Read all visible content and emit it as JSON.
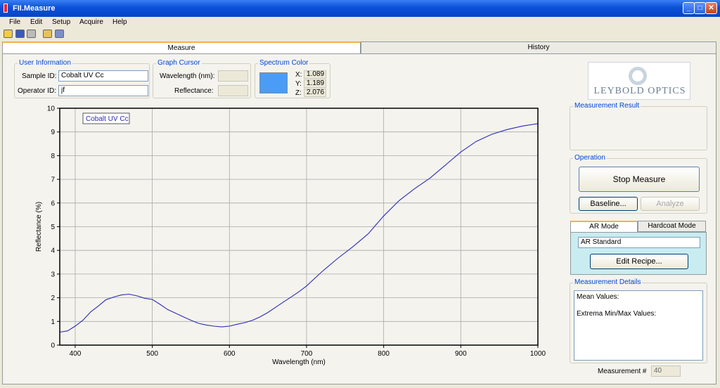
{
  "window": {
    "title": "FII.Measure"
  },
  "menu": {
    "items": [
      "File",
      "Edit",
      "Setup",
      "Acquire",
      "Help"
    ]
  },
  "toolbar": {
    "icons": [
      "open-folder-icon",
      "save-icon",
      "print-icon",
      "export-icon",
      "copy-icon"
    ]
  },
  "tabs": [
    {
      "label": "Measure",
      "active": true
    },
    {
      "label": "History",
      "active": false
    }
  ],
  "user_info": {
    "title": "User Information",
    "sample_label": "Sample ID:",
    "sample_value": "Cobalt UV Cc",
    "operator_label": "Operator ID:",
    "operator_value": "jf"
  },
  "graph_cursor": {
    "title": "Graph Cursor",
    "wavelength_label": "Wavelength (nm):",
    "wavelength_value": "",
    "reflectance_label": "Reflectance:",
    "reflectance_value": ""
  },
  "spectrum_color": {
    "title": "Spectrum Color",
    "swatch_color": "#4a9cf5",
    "x_label": "X:",
    "x_value": "1.089",
    "y_label": "Y:",
    "y_value": "1.189",
    "z_label": "Z:",
    "z_value": "2.076"
  },
  "logo": {
    "text": "LEYBOLD OPTICS"
  },
  "measurement_result": {
    "title": "Measurement Result"
  },
  "operation": {
    "title": "Operation",
    "stop_label": "Stop Measure",
    "baseline_label": "Baseline...",
    "analyze_label": "Analyze"
  },
  "mode_tabs": [
    {
      "label": "AR Mode",
      "active": true
    },
    {
      "label": "Hardcoat Mode",
      "active": false
    }
  ],
  "ar_mode": {
    "recipe_value": "AR Standard",
    "edit_label": "Edit Recipe..."
  },
  "measurement_details": {
    "title": "Measurement Details",
    "mean_label": "Mean Values:",
    "extrema_label": "Extrema Min/Max Values:"
  },
  "measurement_number": {
    "label": "Measurement #",
    "value": "40"
  },
  "colors": {
    "series": "#2b2bb8",
    "title_bar": "#0a50d8",
    "mode_panel": "#c9ecf0"
  },
  "chart_data": {
    "type": "line",
    "xlabel": "Wavelength (nm)",
    "ylabel": "Reflectance (%)",
    "xlim": [
      380,
      1000
    ],
    "ylim": [
      0,
      10
    ],
    "xticks": [
      400,
      500,
      600,
      700,
      800,
      900,
      1000
    ],
    "yticks": [
      0,
      1,
      2,
      3,
      4,
      5,
      6,
      7,
      8,
      9,
      10
    ],
    "grid": true,
    "legend": "top-left",
    "series": [
      {
        "name": "Cobalt UV Cc",
        "x": [
          380,
          390,
          400,
          410,
          420,
          430,
          440,
          450,
          460,
          470,
          480,
          490,
          500,
          510,
          520,
          530,
          540,
          550,
          560,
          570,
          580,
          590,
          600,
          610,
          620,
          630,
          640,
          650,
          660,
          670,
          680,
          690,
          700,
          720,
          740,
          760,
          780,
          800,
          820,
          840,
          860,
          880,
          900,
          920,
          940,
          960,
          980,
          1000
        ],
        "y": [
          0.55,
          0.6,
          0.8,
          1.05,
          1.4,
          1.65,
          1.92,
          2.03,
          2.12,
          2.15,
          2.08,
          1.98,
          1.93,
          1.72,
          1.5,
          1.35,
          1.2,
          1.05,
          0.92,
          0.85,
          0.8,
          0.77,
          0.8,
          0.88,
          0.95,
          1.05,
          1.2,
          1.38,
          1.6,
          1.82,
          2.03,
          2.25,
          2.5,
          3.1,
          3.65,
          4.15,
          4.7,
          5.45,
          6.1,
          6.6,
          7.05,
          7.6,
          8.15,
          8.6,
          8.9,
          9.1,
          9.25,
          9.35
        ]
      }
    ]
  }
}
